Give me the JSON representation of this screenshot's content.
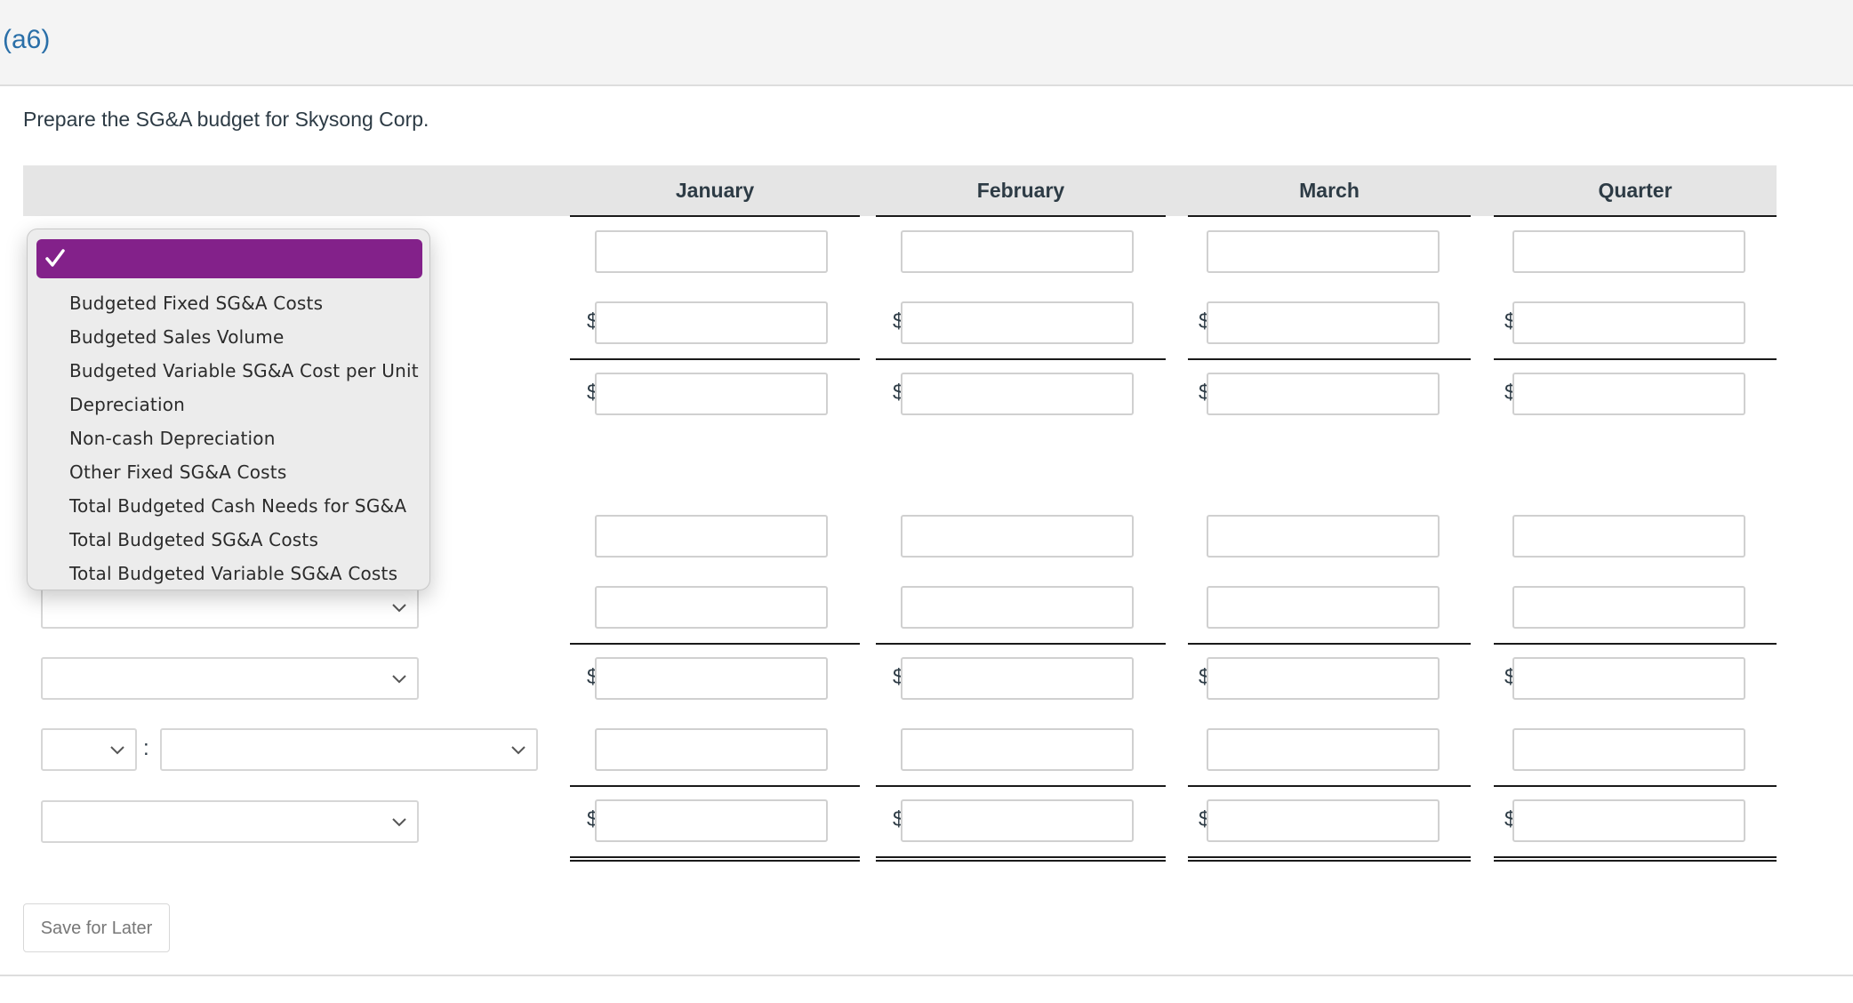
{
  "part_label": "(a6)",
  "prompt": "Prepare the SG&A budget for Skysong Corp.",
  "columns": [
    "January",
    "February",
    "March",
    "Quarter"
  ],
  "currency_symbol": "$",
  "rows": [
    {
      "label_control": "select-open",
      "dollar": false,
      "value": [
        "",
        "",
        "",
        ""
      ]
    },
    {
      "label_control": "select",
      "dollar": true,
      "value": [
        "",
        "",
        "",
        ""
      ]
    },
    {
      "label_control": "select",
      "dollar": true,
      "value": [
        "",
        "",
        "",
        ""
      ]
    },
    {
      "label_control": "select",
      "dollar": false,
      "value": [
        "",
        "",
        "",
        ""
      ]
    },
    {
      "label_control": "select",
      "dollar": false,
      "value": [
        "",
        "",
        "",
        ""
      ]
    },
    {
      "label_control": "select",
      "dollar": true,
      "value": [
        "",
        "",
        "",
        ""
      ]
    },
    {
      "label_control": "select-pair",
      "dollar": false,
      "value": [
        "",
        "",
        "",
        ""
      ]
    },
    {
      "label_control": "select",
      "dollar": true,
      "value": [
        "",
        "",
        "",
        ""
      ]
    }
  ],
  "row_select_values": [
    "",
    "",
    "",
    "",
    "",
    "",
    "",
    ""
  ],
  "row7_colon": ":",
  "dropdown": {
    "selected_value": "",
    "options": [
      "Budgeted Fixed SG&A Costs",
      "Budgeted Sales Volume",
      "Budgeted Variable SG&A Cost per Unit",
      "Depreciation",
      "Non-cash Depreciation",
      "Other Fixed SG&A Costs",
      "Total Budgeted Cash Needs for SG&A",
      "Total Budgeted SG&A Costs",
      "Total Budgeted Variable SG&A Costs"
    ],
    "highlight_color": "#83218a"
  },
  "save_button_label": "Save for Later",
  "colors": {
    "link_blue": "#2a6fa8",
    "text": "#2d3b45",
    "header_bg": "#e5e5e5"
  }
}
